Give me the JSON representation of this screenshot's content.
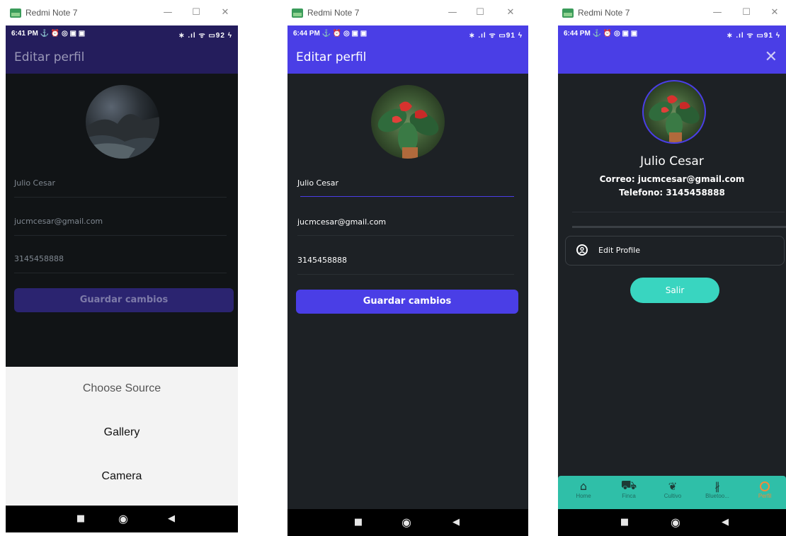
{
  "windows": [
    {
      "title": "Redmi Note 7",
      "status_time": "6:41 PM ⚓ ⏰ ◎ ▣ ▣",
      "status_right": "∗ .ıl ᯤ ▭92 ϟ",
      "appbar_title": "Editar perfil",
      "fields": [
        "Julio Cesar",
        "jucmcesar@gmail.com",
        "3145458888"
      ],
      "save_button": "Guardar cambios",
      "sheet": {
        "title": "Choose Source",
        "options": [
          "Gallery",
          "Camera"
        ]
      }
    },
    {
      "title": "Redmi Note 7",
      "status_time": "6:44 PM ⚓ ⏰ ◎ ▣ ▣",
      "status_right": "∗ .ıl ᯤ ▭91 ϟ",
      "appbar_title": "Editar perfil",
      "fields": [
        "Julio Cesar",
        "jucmcesar@gmail.com",
        "3145458888"
      ],
      "save_button": "Guardar cambios"
    },
    {
      "title": "Redmi Note 7",
      "status_time": "6:44 PM ⚓ ⏰ ◎ ▣ ▣",
      "status_right": "∗ .ıl ᯤ ▭91 ϟ",
      "close_icon": "close-icon",
      "profile_name": "Julio Cesar",
      "profile_email": "Correo: jucmcesar@gmail.com",
      "profile_phone": "Telefono: 3145458888",
      "edit_profile": "Edit Profile",
      "logout": "Salir",
      "bottom_nav": [
        {
          "label": "Home",
          "icon": "home-icon"
        },
        {
          "label": "Finca",
          "icon": "tractor-icon"
        },
        {
          "label": "Cultivo",
          "icon": "leaf-icon"
        },
        {
          "label": "Bluetoo...",
          "icon": "bluetooth-icon"
        },
        {
          "label": "Perfil",
          "icon": "profile-icon"
        }
      ]
    }
  ],
  "colors": {
    "primary": "#4a3ee6",
    "primary_dim": "#2b2470",
    "background": "#1d2125",
    "background_dim": "#111416",
    "teal": "#39d5c0",
    "nav_teal": "#2fbfa8",
    "nav_active": "#f28b3a"
  }
}
